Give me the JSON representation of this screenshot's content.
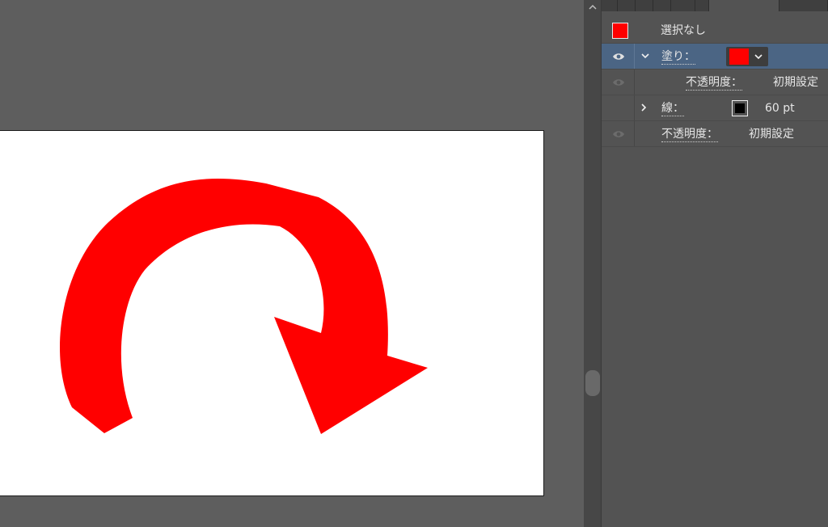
{
  "appearance_panel": {
    "target_label": "選択なし",
    "fill": {
      "label": "塗り：",
      "color": "#ff0000",
      "opacity_label": "不透明度：",
      "opacity_value": "初期設定"
    },
    "stroke": {
      "label": "線：",
      "color": "#000000",
      "weight": "60 pt"
    },
    "object_opacity": {
      "label": "不透明度：",
      "value": "初期設定"
    }
  },
  "colors": {
    "arrow": "#ff0000",
    "canvas_bg": "#5e5e5e",
    "panel_bg": "#535353",
    "selected_row": "#4b6584"
  },
  "icons": {
    "eye": "eye-icon",
    "expand": "chevron-down-icon",
    "collapse": "chevron-right-icon",
    "dropdown": "chevron-down-icon",
    "scroll_up": "chevron-up-icon"
  }
}
